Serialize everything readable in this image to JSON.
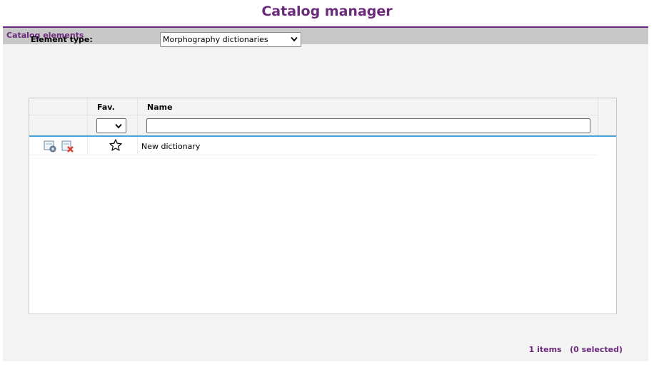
{
  "page": {
    "title": "Catalog manager"
  },
  "panel": {
    "header": "Catalog elements"
  },
  "element_type": {
    "label": "Element type:",
    "selected": "Morphography dictionaries"
  },
  "toolbar": {
    "left_icons": [
      "clear-filter-icon"
    ],
    "right_icons": [
      "add-element-icon",
      "import-element-icon",
      "delete-element-icon",
      "clear-filters-icon"
    ]
  },
  "grid": {
    "columns": [
      {
        "key": "actions",
        "label": ""
      },
      {
        "key": "fav",
        "label": "Fav."
      },
      {
        "key": "name",
        "label": "Name"
      }
    ],
    "filters": {
      "fav": "",
      "name": ""
    },
    "rows": [
      {
        "fav": "star-outline-icon",
        "name": "New dictionary"
      }
    ]
  },
  "status": {
    "text": "1 items   (0 selected)"
  },
  "colors": {
    "accent": "#6b2a7b",
    "header_bg": "#c8c8c8",
    "panel_bg": "#f3f3f3",
    "divider": "#4aa3d8"
  }
}
